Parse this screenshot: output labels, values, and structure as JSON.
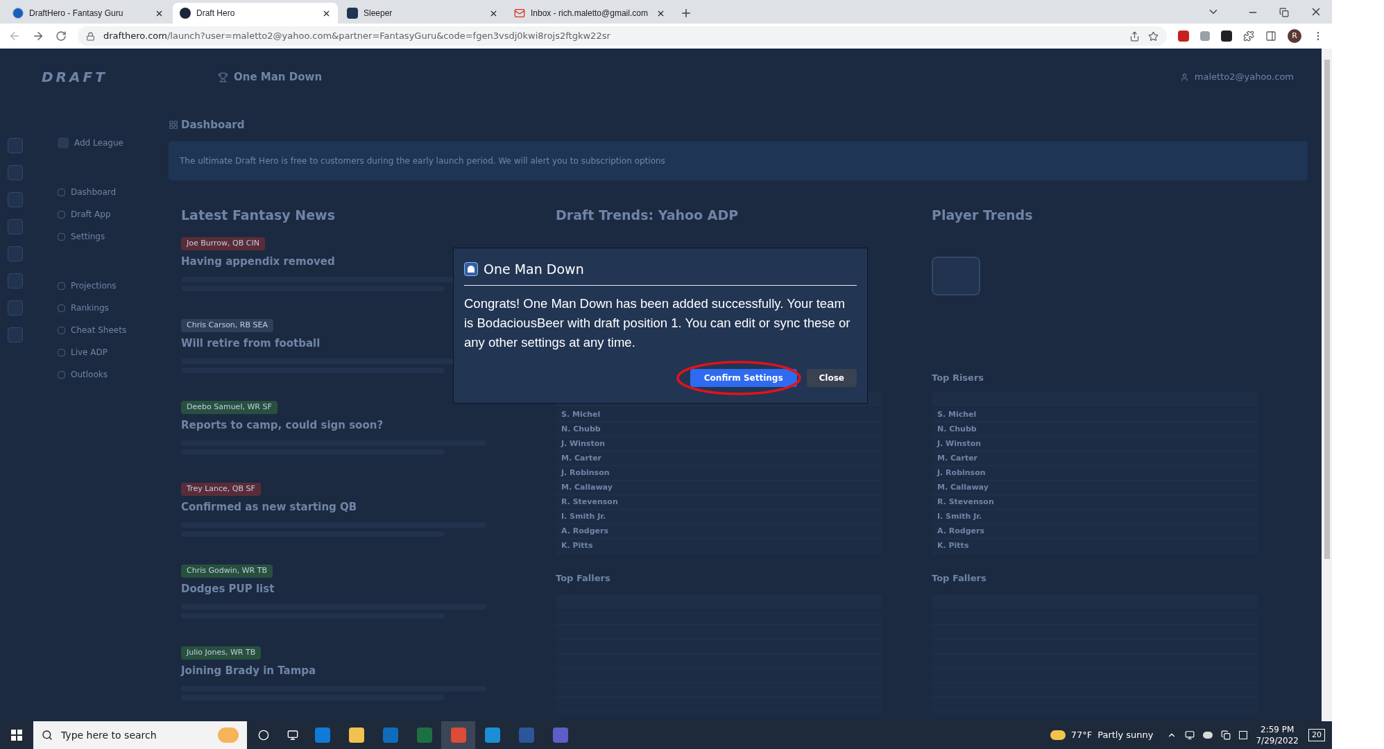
{
  "browser": {
    "tabs": [
      {
        "title": "DraftHero - Fantasy Guru",
        "selected": false
      },
      {
        "title": "Draft Hero",
        "selected": true
      },
      {
        "title": "Sleeper",
        "selected": false
      },
      {
        "title": "Inbox - rich.maletto@gmail.com",
        "selected": false
      }
    ],
    "url_host": "drafthero.com",
    "url_path": "/launch?user=maletto2@yahoo.com&partner=FantasyGuru&code=fgen3vsdj0kwi8rojs2ftgkw22sr",
    "profile_initial": "R"
  },
  "app": {
    "logo": "DRAFT",
    "league": "One Man Down",
    "user": "maletto2@yahoo.com",
    "sidebar": {
      "top": "Add League",
      "groups": [
        [
          "Dashboard",
          "Draft App",
          "Settings"
        ],
        [
          "Projections",
          "Rankings",
          "Cheat Sheets",
          "Live ADP",
          "Outlooks"
        ]
      ]
    },
    "dashboard_title": "Dashboard",
    "banner": "The ultimate Draft Hero is free to customers during the early launch period. We will alert you to subscription options",
    "news": {
      "title": "Latest Fantasy News",
      "items": [
        {
          "tag": "Joe Burrow, QB CIN",
          "color": "#5a2c3a",
          "headline": "Having appendix removed"
        },
        {
          "tag": "Chris Carson, RB SEA",
          "color": "#2e3f5a",
          "headline": "Will retire from football"
        },
        {
          "tag": "Deebo Samuel, WR SF",
          "color": "#28503f",
          "headline": "Reports to camp, could sign soon?"
        },
        {
          "tag": "Trey Lance, QB SF",
          "color": "#5a2c3a",
          "headline": "Confirmed as new starting QB"
        },
        {
          "tag": "Chris Godwin, WR TB",
          "color": "#28503f",
          "headline": "Dodges PUP list"
        },
        {
          "tag": "Julio Jones, WR TB",
          "color": "#28503f",
          "headline": "Joining Brady in Tampa"
        }
      ]
    },
    "trends": [
      {
        "title": "Draft Trends: Yahoo ADP",
        "risers": [
          "S. Michel",
          "N. Chubb",
          "J. Winston",
          "M. Carter",
          "J. Robinson",
          "M. Callaway",
          "R. Stevenson",
          "I. Smith Jr.",
          "A. Rodgers",
          "K. Pitts"
        ],
        "fallers_title": "Top Fallers"
      },
      {
        "title": "Player Trends",
        "risers_title": "Top Risers",
        "risers": [
          "S. Michel",
          "N. Chubb",
          "J. Winston",
          "M. Carter",
          "J. Robinson",
          "M. Callaway",
          "R. Stevenson",
          "I. Smith Jr.",
          "A. Rodgers",
          "K. Pitts"
        ],
        "fallers_title": "Top Fallers"
      }
    ]
  },
  "modal": {
    "title": "One Man Down",
    "message": "Congrats! One Man Down has been added successfully. Your team is BodaciousBeer with draft position 1. You can edit or sync these or any other settings at any time.",
    "buttons": [
      {
        "label": "Confirm Settings",
        "kind": "primary",
        "circled": true
      },
      {
        "label": "Close",
        "kind": "secondary",
        "circled": false
      }
    ]
  },
  "taskbar": {
    "search_placeholder": "Type here to search",
    "weather": "77°F",
    "forecast": "Partly sunny",
    "time": "2:59 PM",
    "date": "7/29/2022",
    "notifications": "20"
  }
}
